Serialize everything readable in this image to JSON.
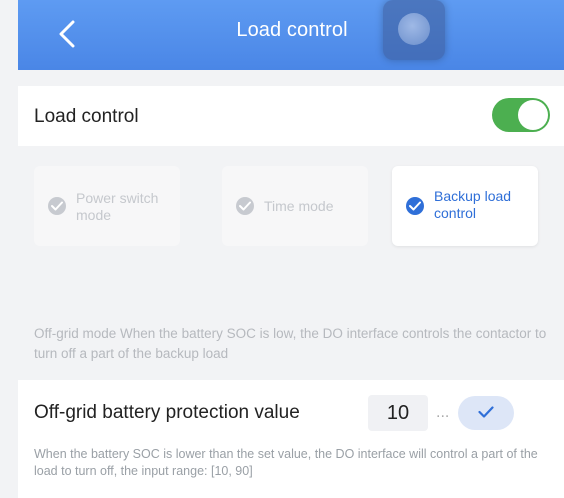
{
  "header": {
    "title": "Load control"
  },
  "load_control": {
    "label": "Load control",
    "enabled": true
  },
  "modes": [
    {
      "label": "Power switch mode",
      "selected": false
    },
    {
      "label": "Time mode",
      "selected": false
    },
    {
      "label": "Backup load control",
      "selected": true
    }
  ],
  "description": "Off-grid mode When the battery SOC is low, the DO interface controls the contactor to turn off a part of the backup load",
  "protection": {
    "label": "Off-grid battery protection value",
    "value": "10",
    "ellipsis": "...",
    "hint": "When the battery SOC is lower than the set value, the DO interface will control a part of the load to turn off, the input range: [10, 90]"
  },
  "colors": {
    "header_blue": "#4a86e6",
    "toggle_green": "#4caf50",
    "accent_blue": "#2f6fd8"
  }
}
